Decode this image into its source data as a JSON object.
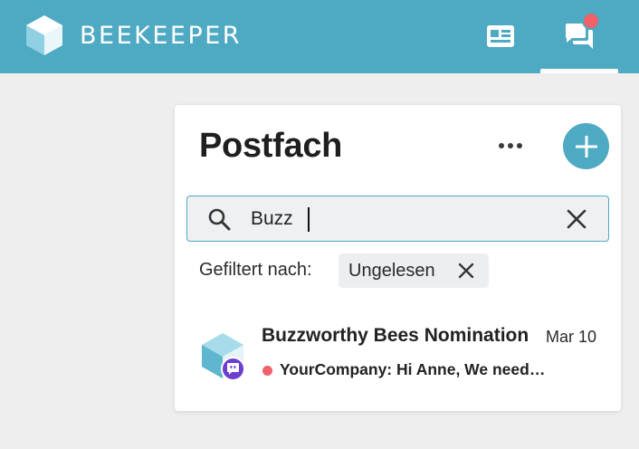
{
  "header": {
    "brand": "BEEKEEPER",
    "accent_color": "#4ea9c3",
    "nav_icons": [
      "newsfeed-icon",
      "chat-icon"
    ],
    "chat_has_notification": true
  },
  "inbox": {
    "title": "Postfach",
    "more_icon": "more-horizontal-icon",
    "add_icon": "plus-icon",
    "search": {
      "value": "Buzz",
      "icon": "search-icon",
      "clear_icon": "close-icon"
    },
    "filter": {
      "label": "Gefiltert nach:",
      "chip_label": "Ungelesen"
    },
    "conversations": [
      {
        "title": "Buzzworthy Bees Nomination",
        "date": "Mar 10",
        "preview": "YourCompany: Hi Anne, We need…",
        "unread": true,
        "badge_icon": "group-chat-icon"
      }
    ]
  }
}
